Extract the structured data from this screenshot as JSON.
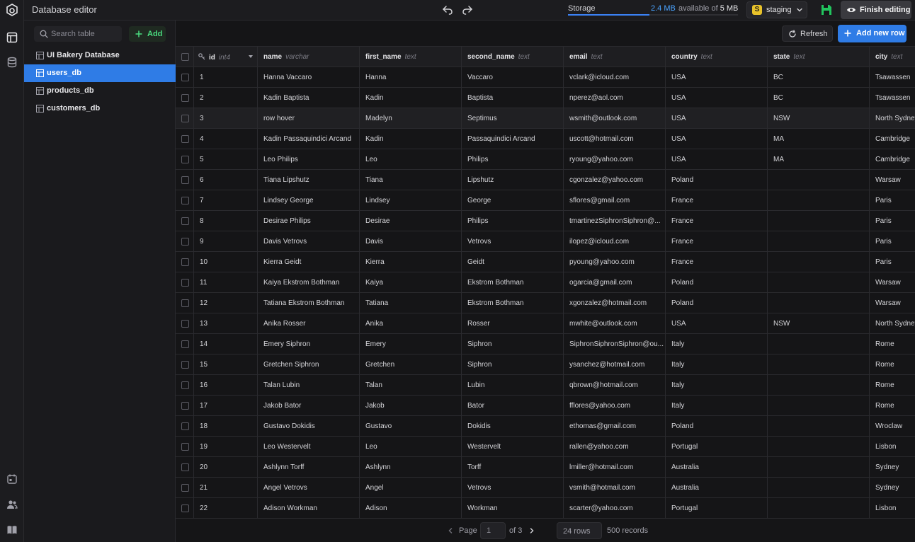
{
  "app": {
    "title": "Database editor"
  },
  "rail": {
    "icons": [
      "app-logo-icon",
      "tables-icon",
      "database-icon",
      "calendar-icon",
      "users-icon",
      "book-icon"
    ]
  },
  "topbar": {
    "storage": {
      "label": "Storage",
      "used": "2.4 MB",
      "available_text": "available of",
      "total": "5 MB",
      "used_fraction": 0.48
    },
    "environment": {
      "badge": "S",
      "label": "staging"
    },
    "finish_label": "Finish editing"
  },
  "sidebar": {
    "search_placeholder": "Search table",
    "add_label": "Add",
    "items": [
      {
        "label": "UI Bakery Database",
        "active": false
      },
      {
        "label": "users_db",
        "active": true
      },
      {
        "label": "products_db",
        "active": false
      },
      {
        "label": "customers_db",
        "active": false
      }
    ]
  },
  "toolbar": {
    "refresh_label": "Refresh",
    "add_row_label": "Add new row"
  },
  "table": {
    "columns": [
      {
        "name": "id",
        "type": "int4"
      },
      {
        "name": "name",
        "type": "varchar"
      },
      {
        "name": "first_name",
        "type": "text"
      },
      {
        "name": "second_name",
        "type": "text"
      },
      {
        "name": "email",
        "type": "text"
      },
      {
        "name": "country",
        "type": "text"
      },
      {
        "name": "state",
        "type": "text"
      },
      {
        "name": "city",
        "type": "text"
      }
    ],
    "hover_row_index": 2,
    "rows": [
      [
        "1",
        "Hanna Vaccaro",
        "Hanna",
        "Vaccaro",
        "vclark@icloud.com",
        "USA",
        "BC",
        "Tsawassen"
      ],
      [
        "2",
        "Kadin Baptista",
        "Kadin",
        "Baptista",
        "nperez@aol.com",
        "USA",
        "BC",
        "Tsawassen"
      ],
      [
        "3",
        "row hover",
        "Madelyn",
        "Septimus",
        "wsmith@outlook.com",
        "USA",
        "NSW",
        "North Sydney"
      ],
      [
        "4",
        "Kadin Passaquindici Arcand",
        "Kadin",
        "Passaquindici Arcand",
        "uscott@hotmail.com",
        "USA",
        "MA",
        "Cambridge"
      ],
      [
        "5",
        "Leo Philips",
        "Leo",
        "Philips",
        "ryoung@yahoo.com",
        "USA",
        "MA",
        "Cambridge"
      ],
      [
        "6",
        "Tiana Lipshutz",
        "Tiana",
        "Lipshutz",
        "cgonzalez@yahoo.com",
        "Poland",
        "",
        "Warsaw"
      ],
      [
        "7",
        "Lindsey George",
        "Lindsey",
        "George",
        "sflores@gmail.com",
        "France",
        "",
        "Paris"
      ],
      [
        "8",
        "Desirae Philips",
        "Desirae",
        "Philips",
        "tmartinezSiphronSiphron@...",
        "France",
        "",
        "Paris"
      ],
      [
        "9",
        "Davis Vetrovs",
        "Davis",
        "Vetrovs",
        "ilopez@icloud.com",
        "France",
        "",
        "Paris"
      ],
      [
        "10",
        "Kierra Geidt",
        "Kierra",
        "Geidt",
        "pyoung@yahoo.com",
        "France",
        "",
        "Paris"
      ],
      [
        "11",
        "Kaiya Ekstrom Bothman",
        "Kaiya",
        "Ekstrom Bothman",
        "ogarcia@gmail.com",
        "Poland",
        "",
        "Warsaw"
      ],
      [
        "12",
        "Tatiana Ekstrom Bothman",
        "Tatiana",
        "Ekstrom Bothman",
        "xgonzalez@hotmail.com",
        "Poland",
        "",
        "Warsaw"
      ],
      [
        "13",
        "Anika Rosser",
        "Anika",
        "Rosser",
        "mwhite@outlook.com",
        "USA",
        "NSW",
        "North Sydney"
      ],
      [
        "14",
        "Emery Siphron",
        "Emery",
        "Siphron",
        "SiphronSiphronSiphron@ou...",
        "Italy",
        "",
        "Rome"
      ],
      [
        "15",
        "Gretchen Siphron",
        "Gretchen",
        "Siphron",
        "ysanchez@hotmail.com",
        "Italy",
        "",
        "Rome"
      ],
      [
        "16",
        "Talan Lubin",
        "Talan",
        "Lubin",
        "qbrown@hotmail.com",
        "Italy",
        "",
        "Rome"
      ],
      [
        "17",
        "Jakob Bator",
        "Jakob",
        "Bator",
        "fflores@yahoo.com",
        "Italy",
        "",
        "Rome"
      ],
      [
        "18",
        "Gustavo Dokidis",
        "Gustavo",
        "Dokidis",
        "ethomas@gmail.com",
        "Poland",
        "",
        "Wroclaw"
      ],
      [
        "19",
        "Leo Westervelt",
        "Leo",
        "Westervelt",
        "rallen@yahoo.com",
        "Portugal",
        "",
        "Lisbon"
      ],
      [
        "20",
        "Ashlynn Torff",
        "Ashlynn",
        "Torff",
        "lmiller@hotmail.com",
        "Australia",
        "",
        "Sydney"
      ],
      [
        "21",
        "Angel Vetrovs",
        "Angel",
        "Vetrovs",
        "vsmith@hotmail.com",
        "Australia",
        "",
        "Sydney"
      ],
      [
        "22",
        "Adison Workman",
        "Adison",
        "Workman",
        "scarter@yahoo.com",
        "Portugal",
        "",
        "Lisbon"
      ],
      [
        "",
        "",
        "",
        "",
        "",
        "",
        "",
        ""
      ]
    ]
  },
  "pagination": {
    "page_label": "Page",
    "page_value": "1",
    "of_label": "of 3",
    "rows_label": "24 rows",
    "records_label": "500 records"
  },
  "colors": {
    "accent": "#2f7ce6",
    "add_green": "#4ade80",
    "env_badge": "#e8c22a",
    "background": "#151517"
  }
}
